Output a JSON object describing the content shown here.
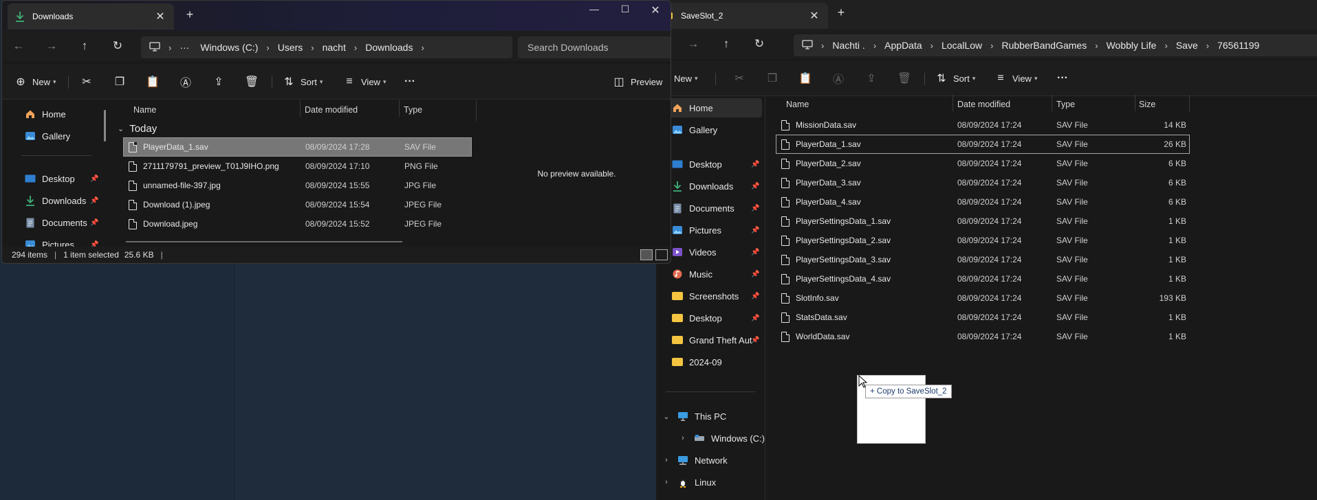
{
  "left_window": {
    "tab_title": "Downloads",
    "address_segments": [
      "Windows (C:)",
      "Users",
      "nacht",
      "Downloads"
    ],
    "search_placeholder": "Search Downloads",
    "toolbar": {
      "new_label": "New",
      "sort_label": "Sort",
      "view_label": "View",
      "preview_label": "Preview"
    },
    "sidebar": [
      {
        "label": "Home",
        "icon": "home-icon"
      },
      {
        "label": "Gallery",
        "icon": "gallery-icon"
      },
      {
        "label": "Desktop",
        "icon": "desktop-icon",
        "pinned": true
      },
      {
        "label": "Downloads",
        "icon": "download-icon",
        "pinned": true
      },
      {
        "label": "Documents",
        "icon": "documents-icon",
        "pinned": true
      },
      {
        "label": "Pictures",
        "icon": "pictures-icon",
        "pinned": true
      }
    ],
    "columns": {
      "name": "Name",
      "date": "Date modified",
      "type": "Type"
    },
    "group_label": "Today",
    "files": [
      {
        "name": "PlayerData_1.sav",
        "date": "08/09/2024 17:28",
        "type": "SAV File",
        "selected": true
      },
      {
        "name": "2711179791_preview_T01J9IHO.png",
        "date": "08/09/2024 17:10",
        "type": "PNG File"
      },
      {
        "name": "unnamed-file-397.jpg",
        "date": "08/09/2024 15:55",
        "type": "JPG File"
      },
      {
        "name": "Download (1).jpeg",
        "date": "08/09/2024 15:54",
        "type": "JPEG File"
      },
      {
        "name": "Download.jpeg",
        "date": "08/09/2024 15:52",
        "type": "JPEG File"
      }
    ],
    "preview_text": "No preview available.",
    "status": {
      "count": "294 items",
      "selected": "1 item selected",
      "size": "25.6 KB"
    }
  },
  "right_window": {
    "tab_title": "SaveSlot_2",
    "address_segments": [
      "Nachti .",
      "AppData",
      "LocalLow",
      "RubberBandGames",
      "Wobbly Life",
      "Save",
      "76561199"
    ],
    "toolbar": {
      "new_label": "New",
      "sort_label": "Sort",
      "view_label": "View"
    },
    "sidebar": [
      {
        "label": "Home",
        "icon": "home-icon",
        "selected": true
      },
      {
        "label": "Gallery",
        "icon": "gallery-icon"
      },
      {
        "label": "Desktop",
        "icon": "desktop-icon",
        "pinned": true
      },
      {
        "label": "Downloads",
        "icon": "download-icon",
        "pinned": true
      },
      {
        "label": "Documents",
        "icon": "documents-icon",
        "pinned": true
      },
      {
        "label": "Pictures",
        "icon": "pictures-icon",
        "pinned": true
      },
      {
        "label": "Videos",
        "icon": "videos-icon",
        "pinned": true
      },
      {
        "label": "Music",
        "icon": "music-icon",
        "pinned": true
      },
      {
        "label": "Screenshots",
        "icon": "folder-icon",
        "pinned": true
      },
      {
        "label": "Desktop",
        "icon": "folder-icon",
        "pinned": true
      },
      {
        "label": "Grand Theft Aut",
        "icon": "folder-icon",
        "pinned": true
      },
      {
        "label": "2024-09",
        "icon": "folder-icon"
      }
    ],
    "tree": [
      {
        "label": "This PC",
        "icon": "pc-icon",
        "expanded": true
      },
      {
        "label": "Windows (C:)",
        "icon": "drive-icon"
      },
      {
        "label": "Network",
        "icon": "network-icon"
      },
      {
        "label": "Linux",
        "icon": "linux-icon"
      }
    ],
    "columns": {
      "name": "Name",
      "date": "Date modified",
      "type": "Type",
      "size": "Size"
    },
    "files": [
      {
        "name": "MissionData.sav",
        "date": "08/09/2024 17:24",
        "type": "SAV File",
        "size": "14 KB"
      },
      {
        "name": "PlayerData_1.sav",
        "date": "08/09/2024 17:24",
        "type": "SAV File",
        "size": "26 KB",
        "outlined": true
      },
      {
        "name": "PlayerData_2.sav",
        "date": "08/09/2024 17:24",
        "type": "SAV File",
        "size": "6 KB"
      },
      {
        "name": "PlayerData_3.sav",
        "date": "08/09/2024 17:24",
        "type": "SAV File",
        "size": "6 KB"
      },
      {
        "name": "PlayerData_4.sav",
        "date": "08/09/2024 17:24",
        "type": "SAV File",
        "size": "6 KB"
      },
      {
        "name": "PlayerSettingsData_1.sav",
        "date": "08/09/2024 17:24",
        "type": "SAV File",
        "size": "1 KB"
      },
      {
        "name": "PlayerSettingsData_2.sav",
        "date": "08/09/2024 17:24",
        "type": "SAV File",
        "size": "1 KB"
      },
      {
        "name": "PlayerSettingsData_3.sav",
        "date": "08/09/2024 17:24",
        "type": "SAV File",
        "size": "1 KB"
      },
      {
        "name": "PlayerSettingsData_4.sav",
        "date": "08/09/2024 17:24",
        "type": "SAV File",
        "size": "1 KB"
      },
      {
        "name": "SlotInfo.sav",
        "date": "08/09/2024 17:24",
        "type": "SAV File",
        "size": "193 KB"
      },
      {
        "name": "StatsData.sav",
        "date": "08/09/2024 17:24",
        "type": "SAV File",
        "size": "1 KB"
      },
      {
        "name": "WorldData.sav",
        "date": "08/09/2024 17:24",
        "type": "SAV File",
        "size": "1 KB"
      }
    ]
  },
  "drag": {
    "tooltip": "+ Copy to SaveSlot_2"
  },
  "colors": {
    "accent_download": "#3fb37a",
    "folder": "#f5c542",
    "selection": "#777777"
  }
}
